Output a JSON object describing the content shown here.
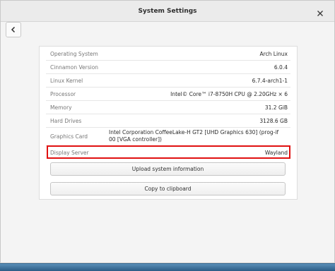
{
  "window": {
    "title": "System Settings"
  },
  "info": {
    "rows": [
      {
        "label": "Operating System",
        "value": "Arch Linux"
      },
      {
        "label": "Cinnamon Version",
        "value": "6.0.4"
      },
      {
        "label": "Linux Kernel",
        "value": "6.7.4-arch1-1"
      },
      {
        "label": "Processor",
        "value": "Intel© Core™ i7-8750H CPU @ 2.20GHz × 6"
      },
      {
        "label": "Memory",
        "value": "31.2 GiB"
      },
      {
        "label": "Hard Drives",
        "value": "3128.6 GB"
      },
      {
        "label": "Graphics Card",
        "value": "Intel Corporation CoffeeLake-H GT2 [UHD Graphics 630] (prog-if 00 [VGA controller])"
      },
      {
        "label": "Display Server",
        "value": "Wayland"
      }
    ]
  },
  "buttons": {
    "upload": "Upload system information",
    "copy": "Copy to clipboard"
  },
  "icons": {
    "close": "close-icon",
    "back": "chevron-left-icon"
  },
  "colors": {
    "highlight": "#e01010"
  }
}
